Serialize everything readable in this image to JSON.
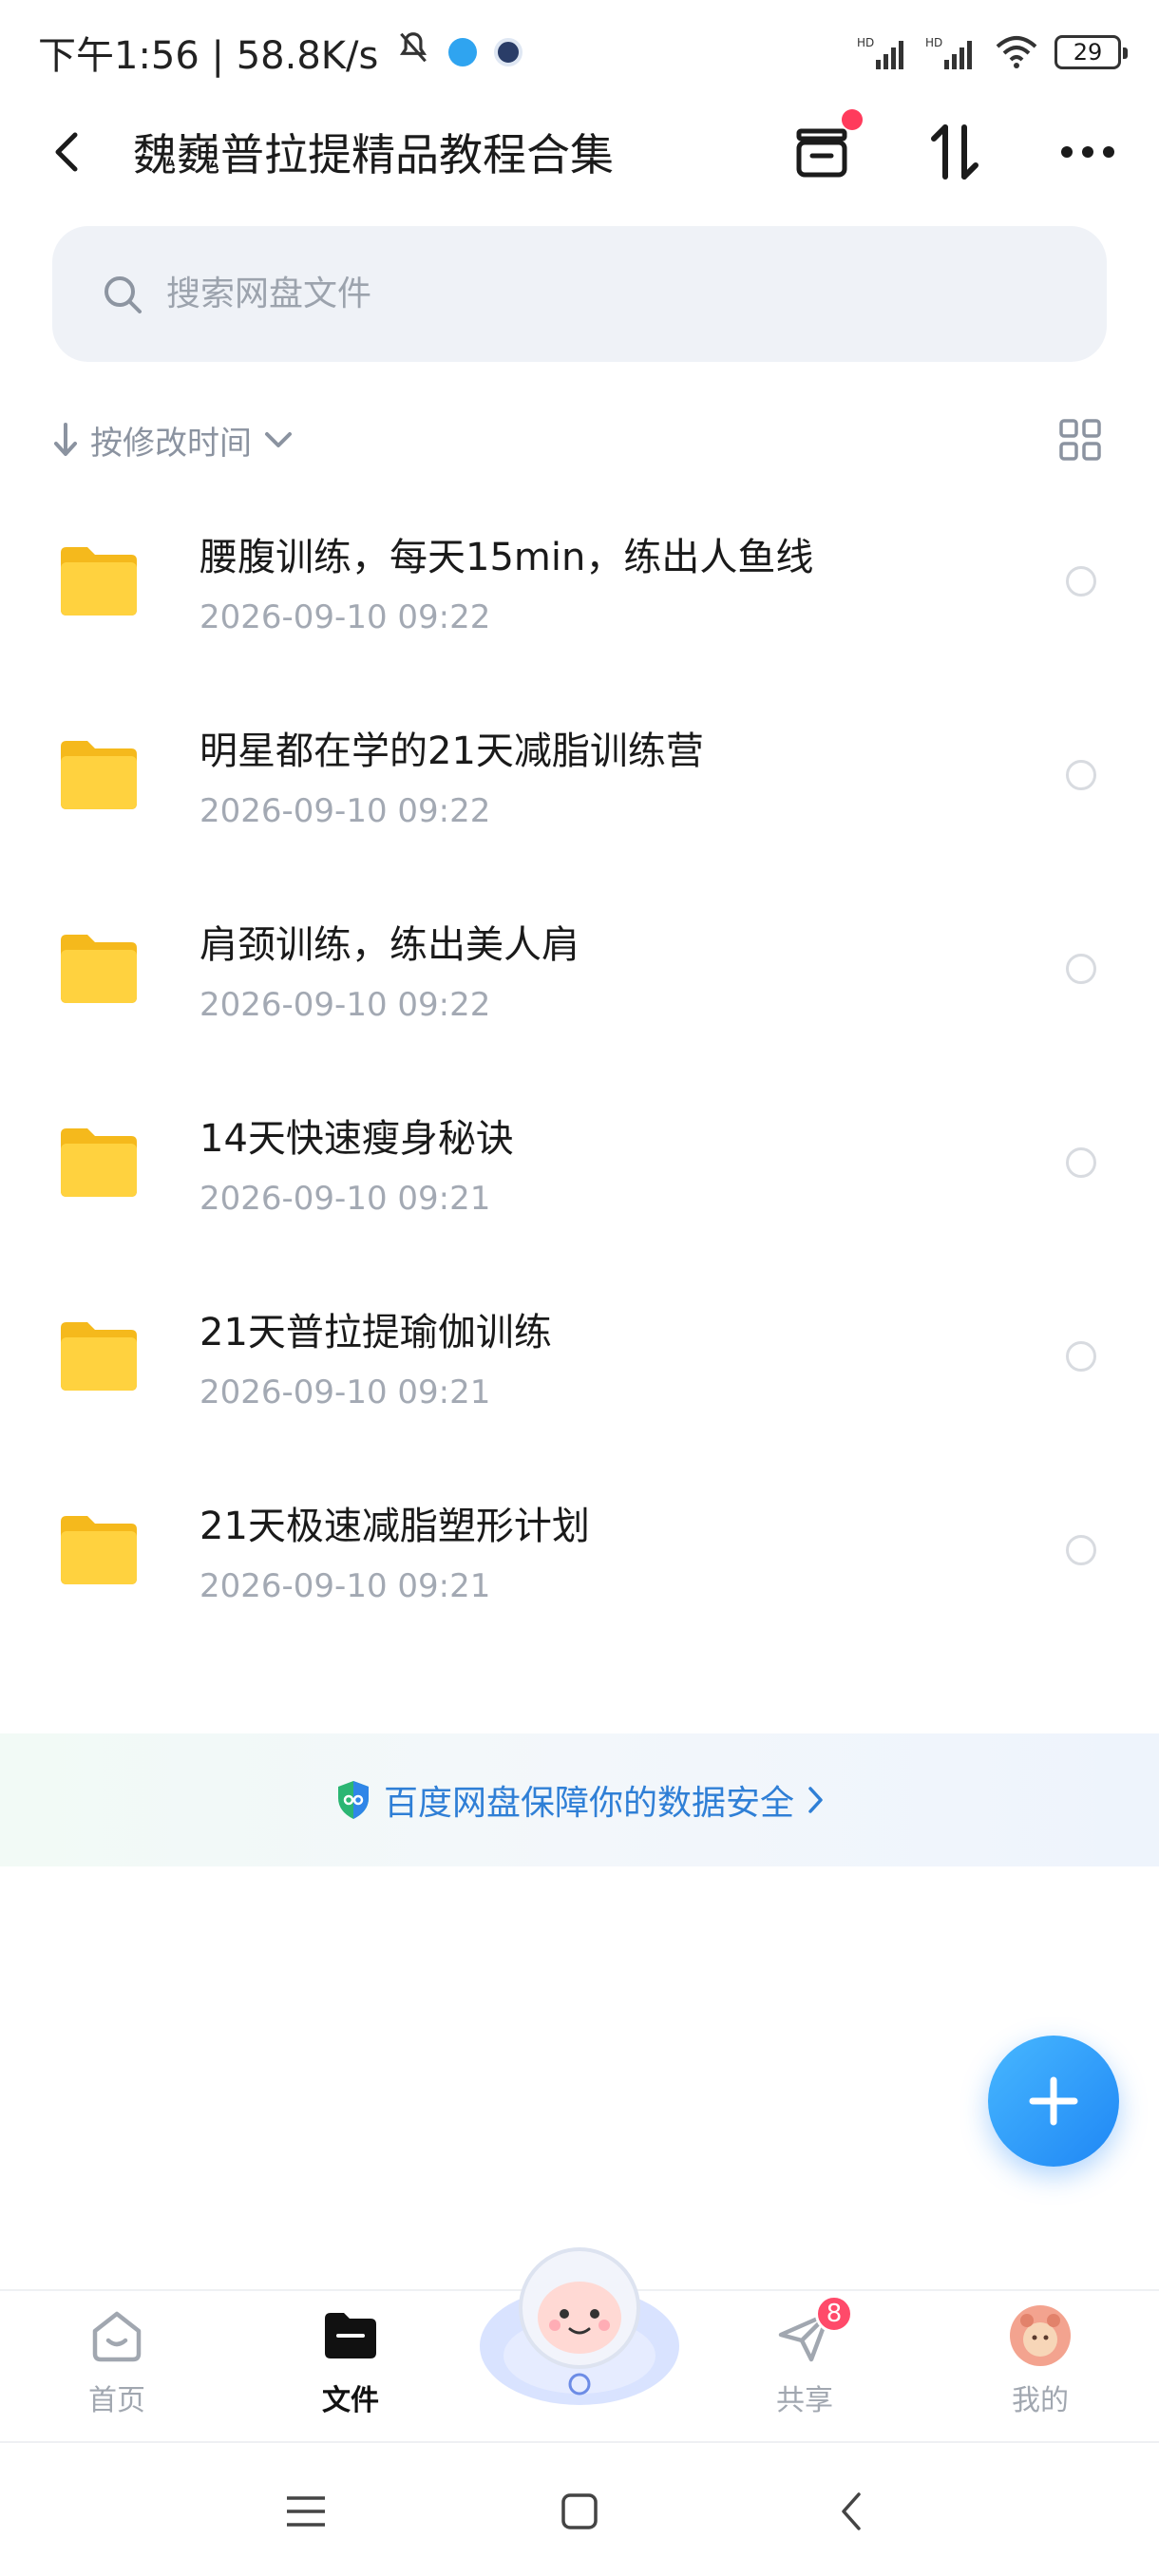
{
  "status_bar": {
    "time_speed": "下午1:56 | 58.8K/s",
    "battery": "29"
  },
  "header": {
    "title": "魏巍普拉提精品教程合集"
  },
  "search": {
    "placeholder": "搜索网盘文件"
  },
  "sort": {
    "label": "按修改时间"
  },
  "files": [
    {
      "name": "腰腹训练，每天15min，练出人鱼线",
      "date": "2026-09-10  09:22"
    },
    {
      "name": "明星都在学的21天减脂训练营",
      "date": "2026-09-10  09:22"
    },
    {
      "name": "肩颈训练，练出美人肩",
      "date": "2026-09-10  09:22"
    },
    {
      "name": "14天快速瘦身秘诀",
      "date": "2026-09-10  09:21"
    },
    {
      "name": "21天普拉提瑜伽训练",
      "date": "2026-09-10  09:21"
    },
    {
      "name": "21天极速减脂塑形计划",
      "date": "2026-09-10  09:21"
    }
  ],
  "safety_banner": {
    "text": "百度网盘保障你的数据安全"
  },
  "bottom_nav": {
    "home": "首页",
    "files": "文件",
    "share": "共享",
    "share_badge": "8",
    "mine": "我的"
  },
  "colors": {
    "accent": "#1f87f5",
    "folder": "#ffc928",
    "badge": "#ff4a6a",
    "banner_text": "#2f7fd6"
  }
}
